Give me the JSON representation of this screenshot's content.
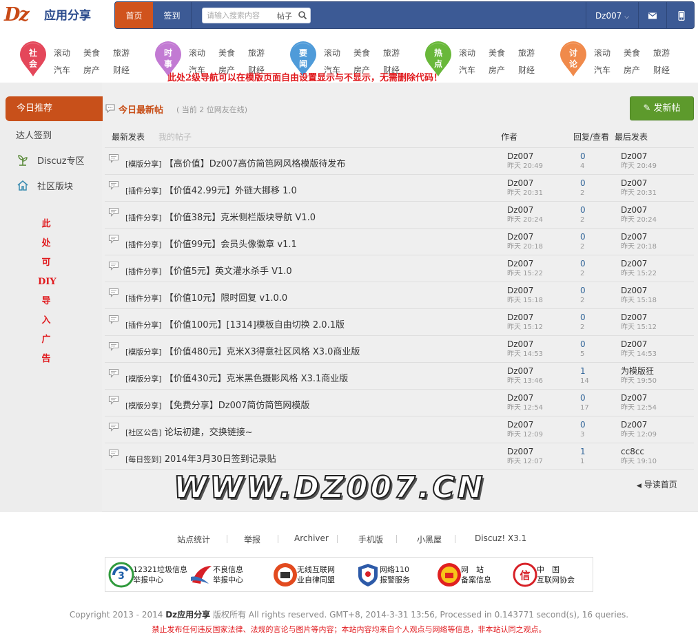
{
  "logo": {
    "mark": "Dz",
    "text": "应用分享"
  },
  "nav": {
    "home": "首页",
    "sign": "签到",
    "search_placeholder": "请输入搜索内容",
    "search_scope": "帖子",
    "user": "Dz007"
  },
  "categories": [
    {
      "pin": "社\n会",
      "color": "#e4475a",
      "links": [
        "滚动",
        "美食",
        "旅游",
        "汽车",
        "房产",
        "财经"
      ]
    },
    {
      "pin": "时\n事",
      "color": "#c27ad3",
      "links": [
        "滚动",
        "美食",
        "旅游",
        "汽车",
        "房产",
        "财经"
      ]
    },
    {
      "pin": "要\n闻",
      "color": "#4f9bd9",
      "links": [
        "滚动",
        "美食",
        "旅游",
        "汽车",
        "房产",
        "财经"
      ]
    },
    {
      "pin": "热\n点",
      "color": "#69b83a",
      "links": [
        "滚动",
        "美食",
        "旅游",
        "汽车",
        "房产",
        "财经"
      ]
    },
    {
      "pin": "讨\n论",
      "color": "#f08a4b",
      "links": [
        "滚动",
        "美食",
        "旅游",
        "汽车",
        "房产",
        "财经"
      ]
    }
  ],
  "subnav_note": "此处2级导航可以在模版页面自由设置显示与不显示，无需删除代码！",
  "sidebar": {
    "active": "今日推荐",
    "items": [
      "达人签到",
      "Discuz专区",
      "社区版块"
    ],
    "diy": "此处可DIY导入广告"
  },
  "main": {
    "title": "今日最新帖",
    "online": "( 当前 2 位网友在线)",
    "new_post": "发新帖",
    "tab_latest": "最新发表",
    "tab_mine": "我的帖子",
    "col_author": "作者",
    "col_reply": "回复/查看",
    "col_last": "最后发表",
    "watermark": "WWW.DZ007.CN",
    "back": "导读首页"
  },
  "threads": [
    {
      "tag": "[模版分享]",
      "title": "【高价值】Dz007高仿简笆网风格模版待发布",
      "author": "Dz007",
      "time": "昨天 20:49",
      "replies": "0",
      "views": "4",
      "last_user": "Dz007",
      "last_time": "昨天 20:49"
    },
    {
      "tag": "[插件分享]",
      "title": "【价值42.99元】外链大挪移 1.0",
      "author": "Dz007",
      "time": "昨天 20:31",
      "replies": "0",
      "views": "2",
      "last_user": "Dz007",
      "last_time": "昨天 20:31"
    },
    {
      "tag": "[插件分享]",
      "title": "【价值38元】克米侧栏版块导航 V1.0",
      "author": "Dz007",
      "time": "昨天 20:24",
      "replies": "0",
      "views": "2",
      "last_user": "Dz007",
      "last_time": "昨天 20:24"
    },
    {
      "tag": "[插件分享]",
      "title": "【价值99元】会员头像徽章 v1.1",
      "author": "Dz007",
      "time": "昨天 20:18",
      "replies": "0",
      "views": "2",
      "last_user": "Dz007",
      "last_time": "昨天 20:18"
    },
    {
      "tag": "[插件分享]",
      "title": "【价值5元】英文灌水杀手 V1.0",
      "author": "Dz007",
      "time": "昨天 15:22",
      "replies": "0",
      "views": "2",
      "last_user": "Dz007",
      "last_time": "昨天 15:22"
    },
    {
      "tag": "[插件分享]",
      "title": "【价值10元】限时回复 v1.0.0",
      "author": "Dz007",
      "time": "昨天 15:18",
      "replies": "0",
      "views": "2",
      "last_user": "Dz007",
      "last_time": "昨天 15:18"
    },
    {
      "tag": "[插件分享]",
      "title": "【价值100元】[1314]模板自由切换 2.0.1版",
      "author": "Dz007",
      "time": "昨天 15:12",
      "replies": "0",
      "views": "2",
      "last_user": "Dz007",
      "last_time": "昨天 15:12"
    },
    {
      "tag": "[模版分享]",
      "title": "【价值480元】克米X3得意社区风格 X3.0商业版",
      "author": "Dz007",
      "time": "昨天 14:53",
      "replies": "0",
      "views": "5",
      "last_user": "Dz007",
      "last_time": "昨天 14:53"
    },
    {
      "tag": "[模版分享]",
      "title": "【价值430元】克米黑色摄影风格 X3.1商业版",
      "author": "Dz007",
      "time": "昨天 13:46",
      "replies": "1",
      "views": "14",
      "last_user": "为模版狂",
      "last_time": "昨天 19:50"
    },
    {
      "tag": "[模版分享]",
      "title": "【免费分享】Dz007简仿简笆网模版",
      "author": "Dz007",
      "time": "昨天 12:54",
      "replies": "0",
      "views": "17",
      "last_user": "Dz007",
      "last_time": "昨天 12:54"
    },
    {
      "tag": "[社区公告]",
      "title": "论坛初建，交换链接~",
      "author": "Dz007",
      "time": "昨天 12:09",
      "replies": "0",
      "views": "3",
      "last_user": "Dz007",
      "last_time": "昨天 12:09"
    },
    {
      "tag": "[每日签到]",
      "title": "2014年3月30日签到记录贴",
      "author": "Dz007",
      "time": "昨天 12:07",
      "replies": "1",
      "views": "1",
      "last_user": "cc8cc",
      "last_time": "昨天 19:10"
    }
  ],
  "footer": {
    "links": [
      "站点统计",
      "举报",
      "Archiver",
      "手机版",
      "小黑屋",
      "Discuz! X3.1"
    ],
    "badges": [
      {
        "l1": "12321垃圾信息",
        "l2": "举报中心",
        "icon": "badge-12321-icon"
      },
      {
        "l1": "不良信息",
        "l2": "举报中心",
        "icon": "badge-report-icon"
      },
      {
        "l1": "无线互联网",
        "l2": "业自律同盟",
        "icon": "badge-wireless-icon"
      },
      {
        "l1": "网络110",
        "l2": "报警服务",
        "icon": "badge-police-icon"
      },
      {
        "l1": "网　站",
        "l2": "备案信息",
        "icon": "badge-record-icon"
      },
      {
        "l1": "中　国",
        "l2": "互联网协会",
        "icon": "badge-isc-icon"
      }
    ],
    "badge_seal_text": "信",
    "copyright_pre": "Copyright 2013 - 2014 ",
    "copyright_site": "Dz应用分享",
    "copyright_post": " 版权所有 All rights reserved. GMT+8, 2014-3-31 13:56, Processed in 0.143771 second(s), 16 queries.",
    "disclaimer": "禁止发布任何违反国家法律、法规的言论与图片等内容；本站内容均来自个人观点与网络等信息，非本站认同之观点。"
  }
}
